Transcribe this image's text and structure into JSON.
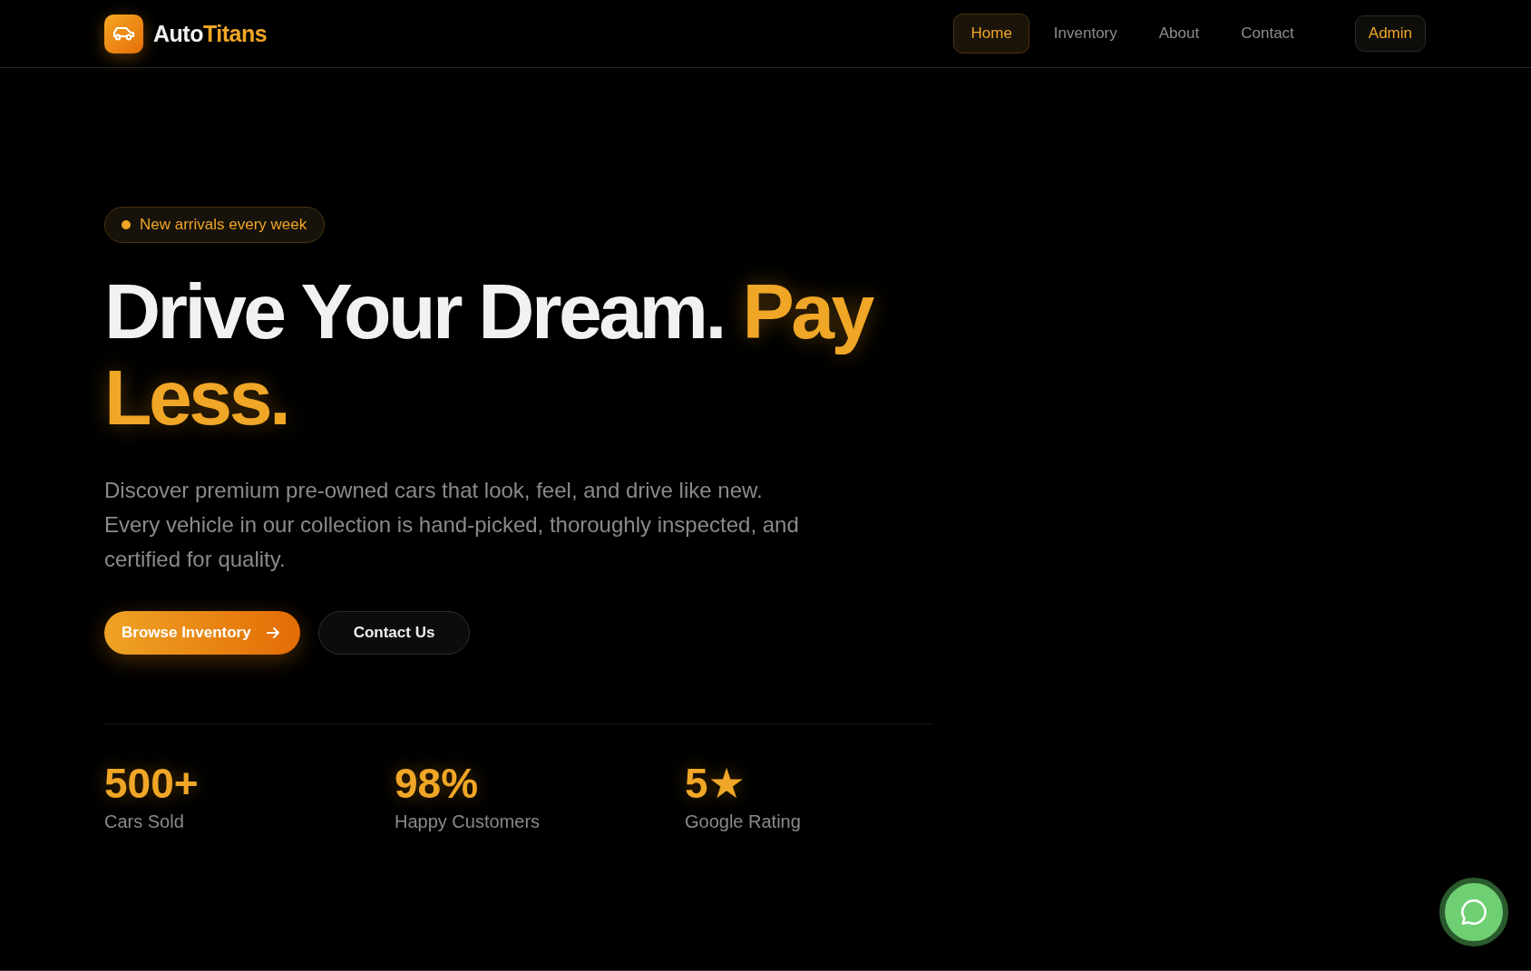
{
  "header": {
    "brand_lead": "Auto",
    "brand_accent": "Titans",
    "nav": [
      {
        "label": "Home",
        "selected": true
      },
      {
        "label": "Inventory",
        "selected": false
      },
      {
        "label": "About",
        "selected": false
      },
      {
        "label": "Contact",
        "selected": false
      }
    ],
    "admin_button": "Admin"
  },
  "hero": {
    "badge": "New arrivals every week",
    "title_lead": "Drive Your Dream.",
    "title_accent": "Pay Less.",
    "description": "Discover premium pre-owned cars that look, feel, and drive like new. Every vehicle in our collection is hand-picked, thoroughly inspected, and certified for quality.",
    "buttons": [
      {
        "label": "Browse Inventory",
        "kind": "primary"
      },
      {
        "label": "Contact Us",
        "kind": "secondary"
      }
    ],
    "stats": [
      {
        "value": "500+",
        "label": "Cars Sold"
      },
      {
        "value": "98%",
        "label": "Happy Customers"
      },
      {
        "value": "5★",
        "label": "Google Rating"
      }
    ]
  }
}
